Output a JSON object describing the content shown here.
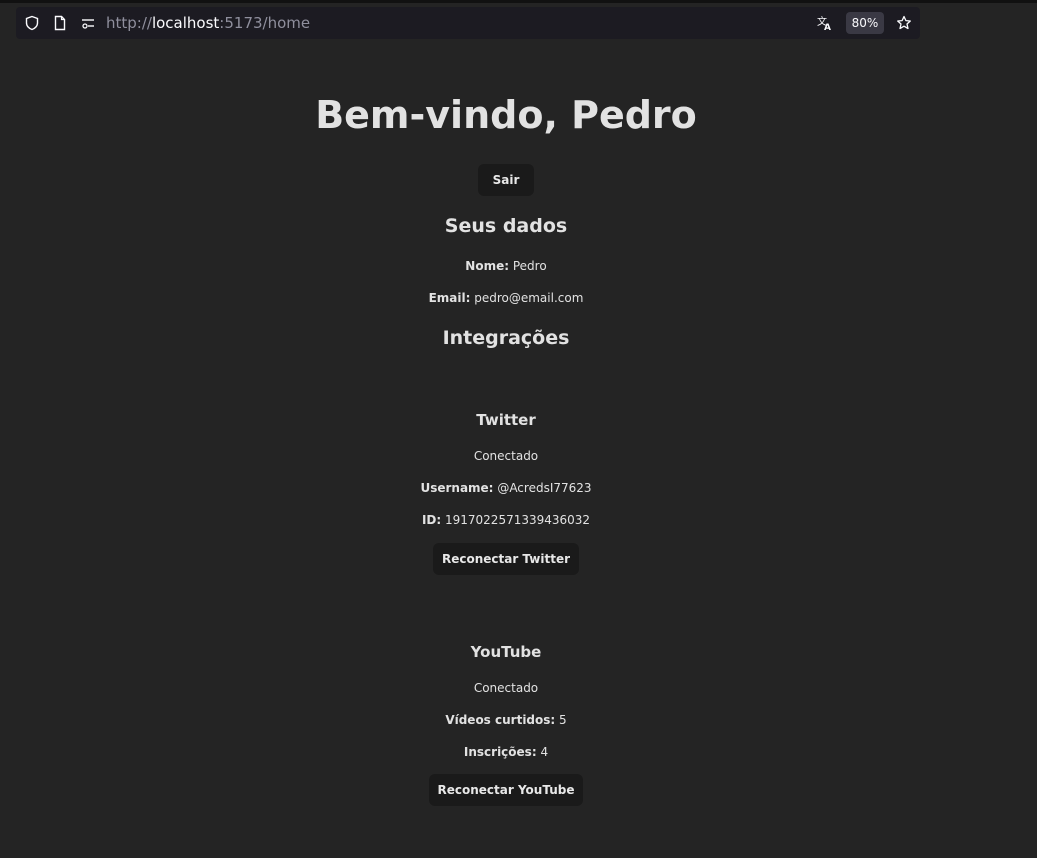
{
  "browser": {
    "url_scheme": "http://",
    "url_host": "localhost",
    "url_path": ":5173/home",
    "zoom": "80%"
  },
  "header": {
    "title": "Bem-vindo, Pedro",
    "logout_label": "Sair"
  },
  "user": {
    "section_title": "Seus dados",
    "name_label": "Nome:",
    "name_value": "Pedro",
    "email_label": "Email:",
    "email_value": "pedro@email.com"
  },
  "integrations": {
    "section_title": "Integrações",
    "twitter": {
      "title": "Twitter",
      "status": "Conectado",
      "username_label": "Username:",
      "username_value": "@AcredsI77623",
      "id_label": "ID:",
      "id_value": "1917022571339436032",
      "reconnect_label": "Reconectar Twitter"
    },
    "youtube": {
      "title": "YouTube",
      "status": "Conectado",
      "liked_label": "Vídeos curtidos:",
      "liked_value": "5",
      "subs_label": "Inscrições:",
      "subs_value": "4",
      "reconnect_label": "Reconectar YouTube"
    }
  }
}
